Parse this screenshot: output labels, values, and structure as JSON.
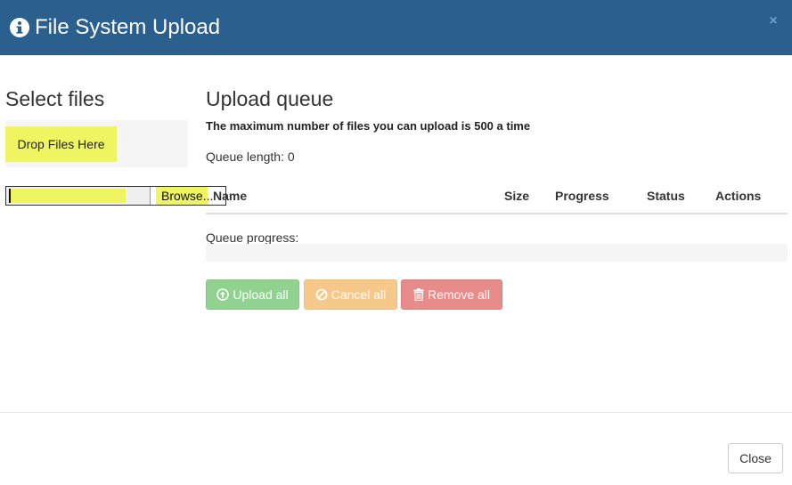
{
  "header": {
    "title": "File System Upload",
    "close_symbol": "×",
    "info_icon": "info-circle-icon",
    "bg_color": "#2b5f8e"
  },
  "select_files": {
    "title": "Select files",
    "drop_label": "Drop Files Here",
    "browse_label": "Browse...",
    "highlight_color": "#eef561"
  },
  "queue": {
    "title": "Upload queue",
    "max_note": "The maximum number of files you can upload is 500 a time",
    "length_label": "Queue length: 0",
    "columns": [
      "Name",
      "Size",
      "Progress",
      "Status",
      "Actions"
    ],
    "progress_label": "Queue progress:",
    "progress_percent": 0
  },
  "buttons": {
    "upload_all": "Upload all",
    "cancel_all": "Cancel all",
    "remove_all": "Remove all",
    "upload_icon": "circle-arrow-up-icon",
    "cancel_icon": "ban-icon",
    "remove_icon": "trash-icon"
  },
  "footer": {
    "close_label": "Close"
  }
}
